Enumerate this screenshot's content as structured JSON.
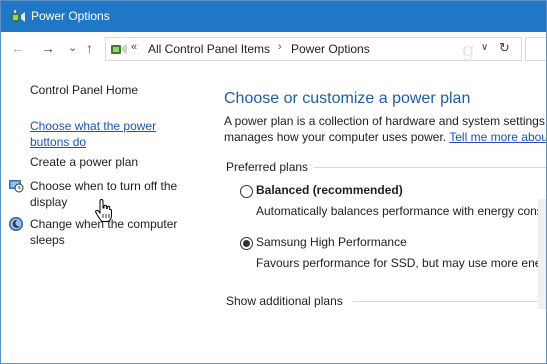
{
  "window": {
    "title": "Power Options"
  },
  "nav": {
    "back": "←",
    "forward": "→",
    "history": "⌄",
    "up": "↑",
    "chevron": "«",
    "crumbs": [
      "All Control Panel Items",
      "Power Options"
    ],
    "separator": "›",
    "dropdown": "∨",
    "refresh": "↻",
    "watermark": "g"
  },
  "sidebar": {
    "home": "Control Panel Home",
    "link_power_buttons": [
      "Choose what the power",
      "buttons do"
    ],
    "create_plan": "Create a power plan",
    "turn_off_display": [
      "Choose when to turn off the",
      "display"
    ],
    "sleep": [
      "Change when the computer",
      "sleeps"
    ]
  },
  "main": {
    "title": "Choose or customize a power plan",
    "desc_line1": "A power plan is a collection of hardware and system settings (",
    "desc_line2": "manages how your computer uses power.",
    "learn_more": "Tell me more abou",
    "preferred_label": "Preferred plans",
    "plans": [
      {
        "name": "Balanced (recommended)",
        "desc": "Automatically balances performance with energy consu",
        "selected": false
      },
      {
        "name": "Samsung High Performance",
        "desc": "Favours performance for SSD, but may use more energy",
        "selected": true
      }
    ],
    "show_additional": "Show additional plans"
  },
  "colors": {
    "titlebar": "#1f78c7",
    "link": "#1a52b8",
    "heading": "#1a5fa8"
  }
}
